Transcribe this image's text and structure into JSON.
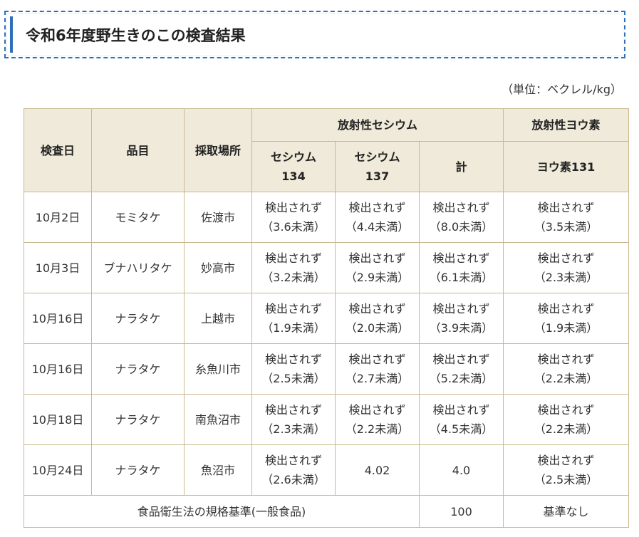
{
  "title": "令和6年度野生きのこの検査結果",
  "unit": "（単位：ベクレル/kg）",
  "header": {
    "date": "検査日",
    "item": "品目",
    "place": "採取場所",
    "cesium_group": "放射性セシウム",
    "iodine_group": "放射性ヨウ素",
    "cs134_line1": "セシウム",
    "cs134_line2": "134",
    "cs137_line1": "セシウム",
    "cs137_line2": "137",
    "total": "計",
    "iodine131": "ヨウ素131"
  },
  "rows": [
    {
      "date": "10月2日",
      "item": "モミタケ",
      "place": "佐渡市",
      "cs134_a": "検出されず",
      "cs134_b": "（3.6未満）",
      "cs137_a": "検出されず",
      "cs137_b": "（4.4未満）",
      "total_a": "検出されず",
      "total_b": "（8.0未満）",
      "i131_a": "検出されず",
      "i131_b": "（3.5未満）"
    },
    {
      "date": "10月3日",
      "item": "ブナハリタケ",
      "place": "妙高市",
      "cs134_a": "検出されず",
      "cs134_b": "（3.2未満）",
      "cs137_a": "検出されず",
      "cs137_b": "（2.9未満）",
      "total_a": "検出されず",
      "total_b": "（6.1未満）",
      "i131_a": "検出されず",
      "i131_b": "（2.3未満）"
    },
    {
      "date": "10月16日",
      "item": "ナラタケ",
      "place": "上越市",
      "cs134_a": "検出されず",
      "cs134_b": "（1.9未満）",
      "cs137_a": "検出されず",
      "cs137_b": "（2.0未満）",
      "total_a": "検出されず",
      "total_b": "（3.9未満）",
      "i131_a": "検出されず",
      "i131_b": "（1.9未満）"
    },
    {
      "date": "10月16日",
      "item": "ナラタケ",
      "place": "糸魚川市",
      "cs134_a": "検出されず",
      "cs134_b": "（2.5未満）",
      "cs137_a": "検出されず",
      "cs137_b": "（2.7未満）",
      "total_a": "検出されず",
      "total_b": "（5.2未満）",
      "i131_a": "検出されず",
      "i131_b": "（2.2未満）"
    },
    {
      "date": "10月18日",
      "item": "ナラタケ",
      "place": "南魚沼市",
      "cs134_a": "検出されず",
      "cs134_b": "（2.3未満）",
      "cs137_a": "検出されず",
      "cs137_b": "（2.2未満）",
      "total_a": "検出されず",
      "total_b": "（4.5未満）",
      "i131_a": "検出されず",
      "i131_b": "（2.2未満）"
    },
    {
      "date": "10月24日",
      "item": "ナラタケ",
      "place": "魚沼市",
      "cs134_a": "検出されず",
      "cs134_b": "（2.6未満）",
      "cs137_a": "4.02",
      "cs137_b": "",
      "total_a": "4.0",
      "total_b": "",
      "i131_a": "検出されず",
      "i131_b": "（2.5未満）"
    }
  ],
  "standard": {
    "label": "食品衛生法の規格基準(一般食品)",
    "cesium": "100",
    "iodine": "基準なし"
  },
  "colors": {
    "accent": "#2e70b8",
    "header_bg": "#efead9",
    "border": "#c9b98e"
  }
}
